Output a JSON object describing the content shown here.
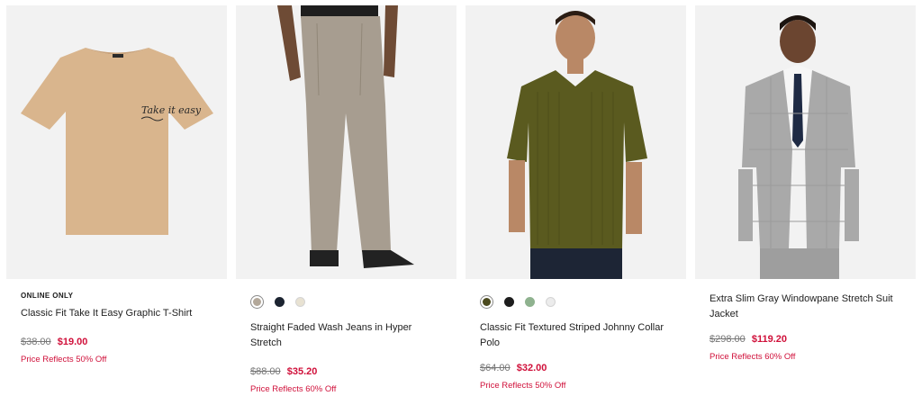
{
  "products": [
    {
      "badge": "ONLINE ONLY",
      "title": "Classic Fit Take It Easy Graphic T-Shirt",
      "was_price": "$38.00",
      "sale_price": "$19.00",
      "promo": "Price Reflects 50% Off",
      "swatches": [],
      "tee_print": "Take it easy"
    },
    {
      "badge": "",
      "title": "Straight Faded Wash Jeans in Hyper Stretch",
      "was_price": "$88.00",
      "sale_price": "$35.20",
      "promo": "Price Reflects 60% Off",
      "swatches": [
        "#b3a89a",
        "#1c2431",
        "#e8e2d2"
      ]
    },
    {
      "badge": "",
      "title": "Classic Fit Textured Striped Johnny Collar Polo",
      "was_price": "$64.00",
      "sale_price": "$32.00",
      "promo": "Price Reflects 50% Off",
      "swatches": [
        "#4b4a1e",
        "#1d1d1d",
        "#8fb28f",
        "#ececec"
      ]
    },
    {
      "badge": "",
      "title": "Extra Slim Gray Windowpane Stretch Suit Jacket",
      "was_price": "$298.00",
      "sale_price": "$119.20",
      "promo": "Price Reflects 60% Off",
      "swatches": []
    }
  ],
  "colors": {
    "sale": "#d0103a",
    "image_bg": "#f2f2f2"
  }
}
